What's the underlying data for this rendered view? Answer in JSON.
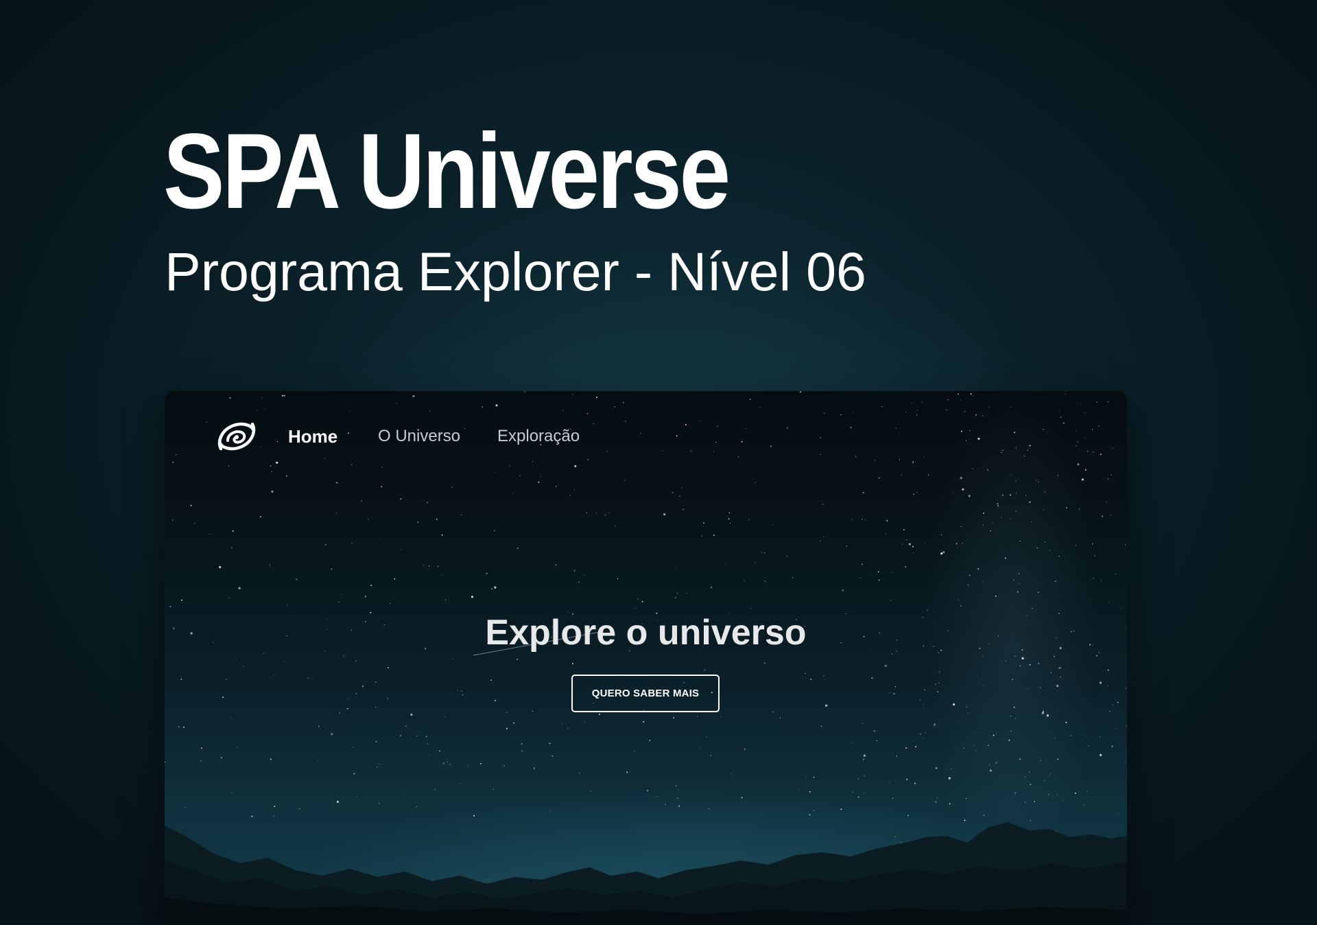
{
  "cover": {
    "title": "SPA Universe",
    "subtitle": "Programa Explorer - Nível 06"
  },
  "preview": {
    "logo_icon": "galaxy-swirl-icon",
    "nav": {
      "items": [
        {
          "label": "Home",
          "active": true
        },
        {
          "label": "O Universo",
          "active": false
        },
        {
          "label": "Exploração",
          "active": false
        }
      ]
    },
    "hero": {
      "title": "Explore o universo",
      "button_label": "QUERO SABER MAIS"
    }
  },
  "colors": {
    "page_background": "#0a1d25",
    "glow": "#17404c",
    "text_primary": "#ffffff",
    "nav_inactive": "#c8ccd0"
  }
}
